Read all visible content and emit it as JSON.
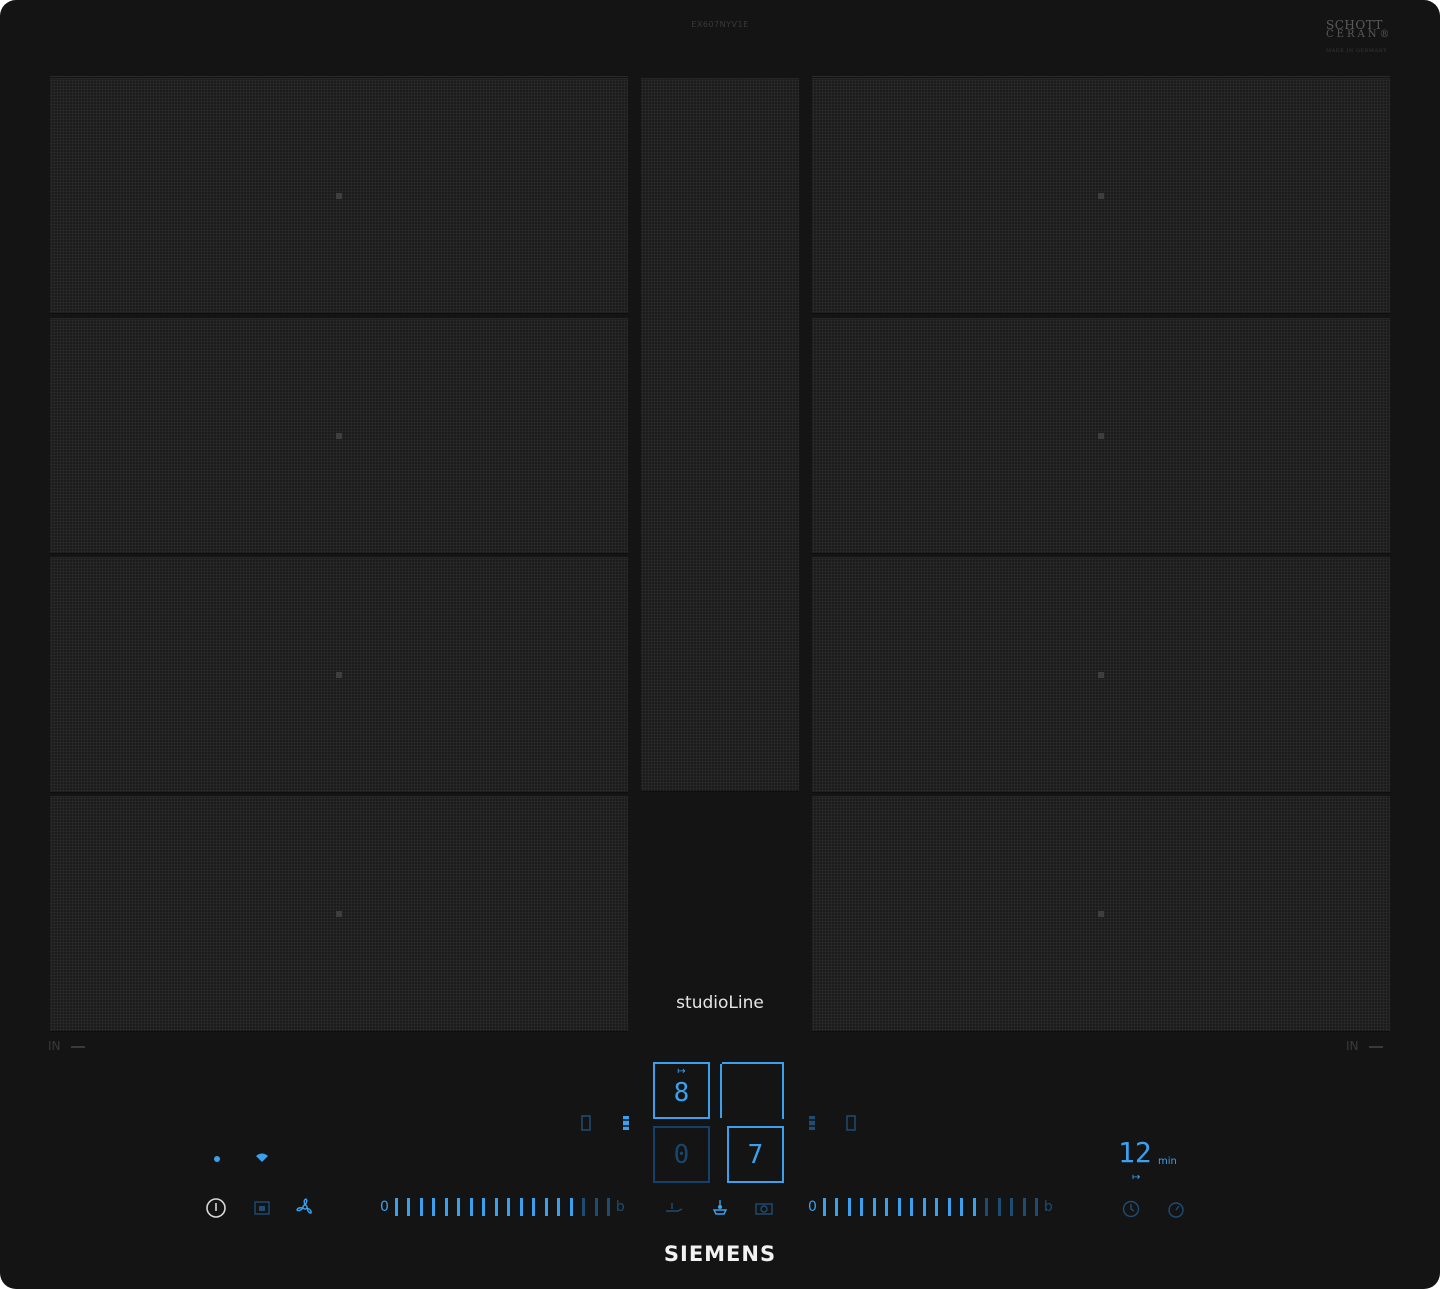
{
  "hob": {
    "model_code": "EX607NYV1E",
    "certification": {
      "line1": "SCHOTT",
      "line2": "CERAN®",
      "line3": "MADE IN GERMANY"
    },
    "series": "studioLine",
    "brand": "SIEMENS",
    "left_marking": "IN",
    "right_marking": "IN"
  },
  "controls": {
    "power_level_top": "8",
    "power_level_bottom_left": "0",
    "power_level_bottom_right": "7",
    "timer_value": "12",
    "timer_unit": "min",
    "left_slider": {
      "start": "0",
      "end": "b",
      "active_ticks": 15,
      "total_ticks": 18
    },
    "right_slider": {
      "start": "0",
      "end": "b",
      "active_ticks": 13,
      "total_ticks": 18
    }
  },
  "icons": [
    "power-icon",
    "lock-icon",
    "fan-icon",
    "pan-icon",
    "fry-sensor-icon",
    "camera-icon",
    "clock-icon",
    "stopwatch-icon",
    "wifi-icon",
    "dot-indicator-icon"
  ],
  "colors": {
    "glass": "#141414",
    "zone": "#1c1c1c",
    "accent": "#3ba1ee",
    "accent_dim": "#1f4c73"
  }
}
